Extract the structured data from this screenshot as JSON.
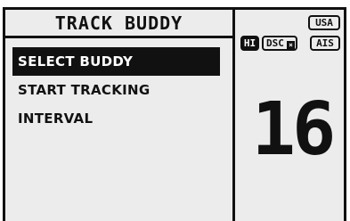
{
  "screen": {
    "title": "TRACK BUDDY",
    "menu_items": [
      {
        "label": "SELECT BUDDY",
        "selected": true
      },
      {
        "label": "START TRACKING",
        "selected": false
      },
      {
        "label": "INTERVAL",
        "selected": false
      }
    ]
  },
  "status": {
    "region": "USA",
    "power": "HI",
    "dsc": "DSC",
    "dsc_mark": "×",
    "ais": "AIS"
  },
  "channel": "16",
  "colors": {
    "background": "#ececec",
    "foreground": "#111111",
    "highlight_text": "#ffffff"
  }
}
